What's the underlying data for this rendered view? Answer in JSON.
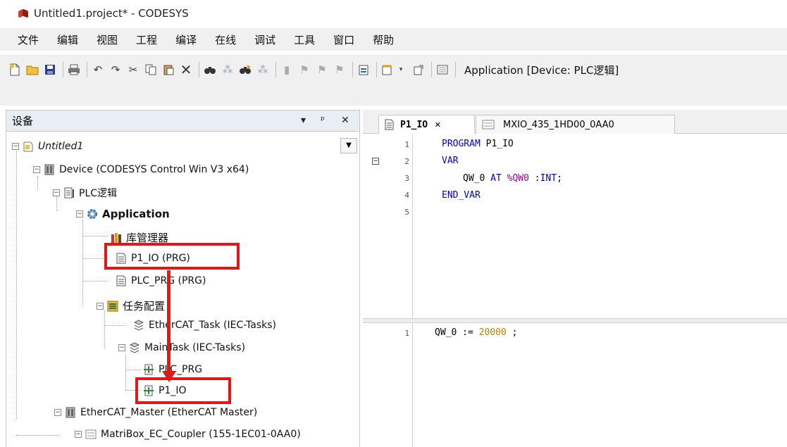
{
  "window": {
    "title": "Untitled1.project* - CODESYS"
  },
  "menu": [
    "文件",
    "编辑",
    "视图",
    "工程",
    "编译",
    "在线",
    "调试",
    "工具",
    "窗口",
    "帮助"
  ],
  "toolbar": {
    "application_label": "Application [Device: PLC逻辑]"
  },
  "devices_panel": {
    "title": "设备",
    "tree": {
      "project": "Untitled1",
      "device": "Device (CODESYS Control Win V3 x64)",
      "plc_logic": "PLC逻辑",
      "application": "Application",
      "library_manager": "库管理器",
      "p1_io": "P1_IO (PRG)",
      "plc_prg": "PLC_PRG (PRG)",
      "task_config": "任务配置",
      "ethercat_task": "EtherCAT_Task (IEC-Tasks)",
      "main_task": "MainTask (IEC-Tasks)",
      "main_task_plc_prg": "PLC_PRG",
      "main_task_p1_io": "P1_IO",
      "ethercat_master": "EtherCAT_Master (EtherCAT Master)",
      "coupler": "MatriBox_EC_Coupler (155-1EC01-0AA0)"
    }
  },
  "editor": {
    "tabs": [
      {
        "label": "P1_IO"
      },
      {
        "label": "MXIO_435_1HD00_0AA0"
      }
    ],
    "declaration": {
      "line_numbers": [
        "1",
        "2",
        "3",
        "4",
        "5"
      ],
      "l1_kw": "PROGRAM",
      "l1_rest": " P1_IO",
      "l2_kw": "VAR",
      "l3_a": "QW_0 ",
      "l3_kw": "AT",
      "l3_addr": " %QW0 ",
      "l3_b": ":",
      "l3_type": "INT",
      "l3_c": ";",
      "l4_kw": "END_VAR"
    },
    "implementation": {
      "line_numbers": [
        "1"
      ],
      "var": "QW_0 := ",
      "value": "20000",
      "end": " ;"
    }
  },
  "colors": {
    "highlight": "#e01818",
    "keyword": "#0000c8",
    "number": "#c08000"
  }
}
